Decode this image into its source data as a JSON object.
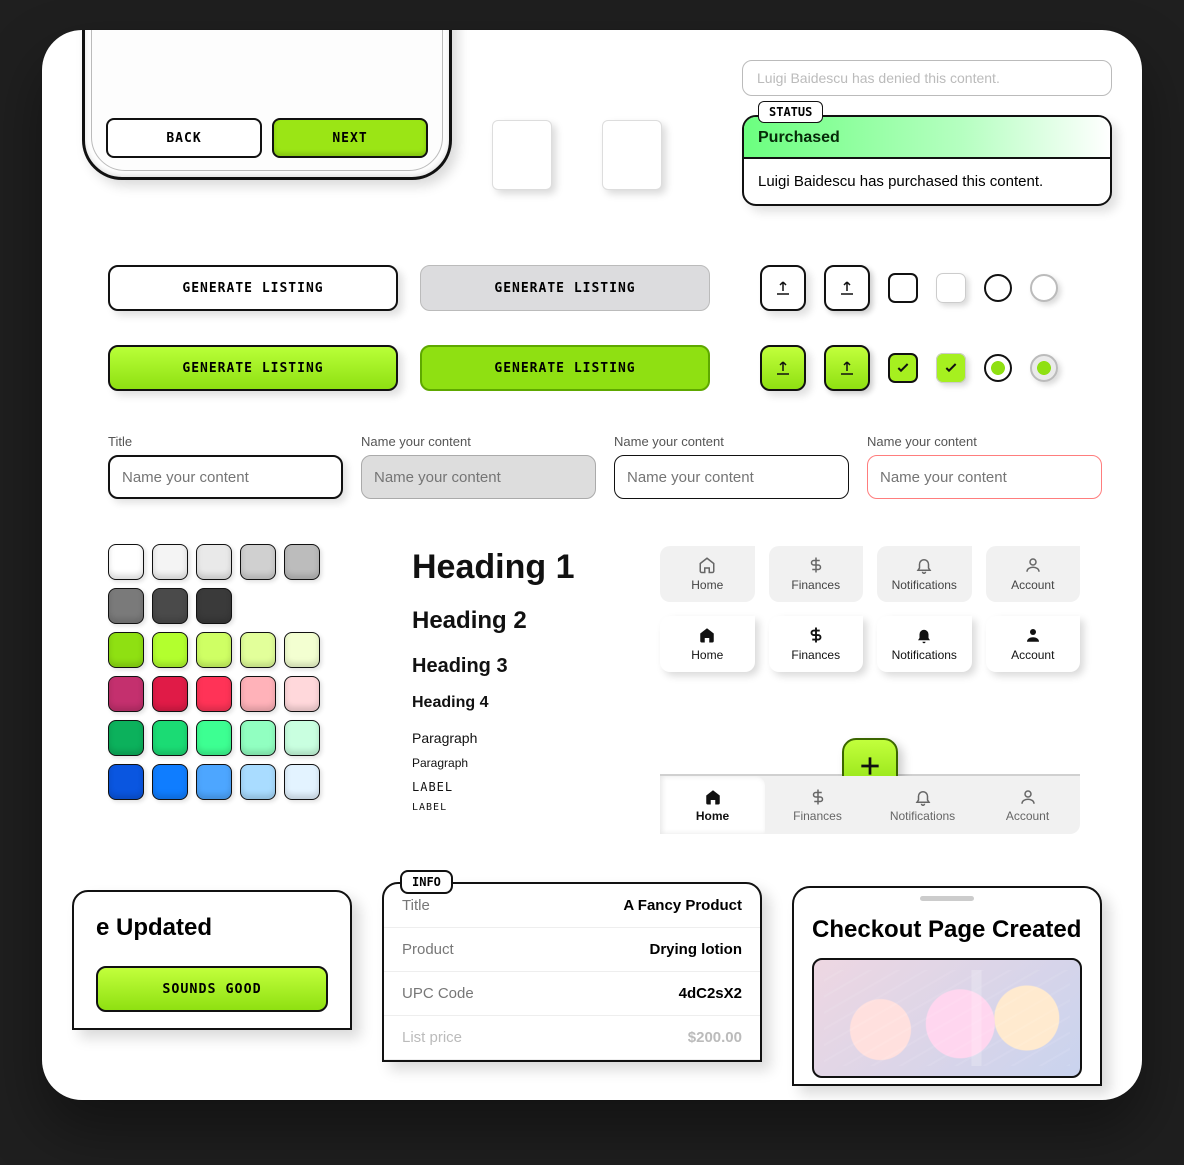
{
  "phone": {
    "back_label": "BACK",
    "next_label": "NEXT"
  },
  "status": {
    "denied_text": "Luigi Baidescu has denied this content.",
    "badge": "STATUS",
    "title": "Purchased",
    "body": "Luigi Baidescu has purchased this content."
  },
  "buttons": {
    "generate_listing": "GENERATE LISTING"
  },
  "inputs": {
    "title_label": "Title",
    "name_label": "Name your content",
    "placeholder": "Name your content"
  },
  "swatches": {
    "row1": [
      "#ffffff",
      "#f4f4f4",
      "#e9e9e9",
      "#d0d0d0",
      "#bcbcbc"
    ],
    "row2": [
      "#7a7a7a",
      "#4a4a4a",
      "#3a3a3a"
    ],
    "row3": [
      "#8fe012",
      "#b3ff2e",
      "#cfff64",
      "#e2ff9a",
      "#f3ffd1"
    ],
    "row4": [
      "#c4306e",
      "#e01b47",
      "#ff3357",
      "#ffb2b9",
      "#ffd8db"
    ],
    "row5": [
      "#0cb15c",
      "#1bdb74",
      "#3dff92",
      "#91ffc1",
      "#c9ffe0"
    ],
    "row6": [
      "#0a56e0",
      "#0f7dff",
      "#4da6ff",
      "#a9dcff",
      "#e3f3ff"
    ]
  },
  "typography": {
    "h1": "Heading 1",
    "h2": "Heading 2",
    "h3": "Heading 3",
    "h4": "Heading 4",
    "p1": "Paragraph",
    "p2": "Paragraph",
    "l1": "LABEL",
    "l2": "LABEL"
  },
  "tabs": {
    "home": "Home",
    "finances": "Finances",
    "notifications": "Notifications",
    "account": "Account"
  },
  "updated": {
    "title": "e Updated",
    "cta": "SOUNDS GOOD"
  },
  "info": {
    "badge": "INFO",
    "rows": [
      {
        "k": "Title",
        "v": "A Fancy Product"
      },
      {
        "k": "Product",
        "v": "Drying lotion"
      },
      {
        "k": "UPC Code",
        "v": "4dC2sX2"
      },
      {
        "k": "List price",
        "v": "$200.00"
      }
    ]
  },
  "checkout": {
    "title": "Checkout Page Created"
  }
}
